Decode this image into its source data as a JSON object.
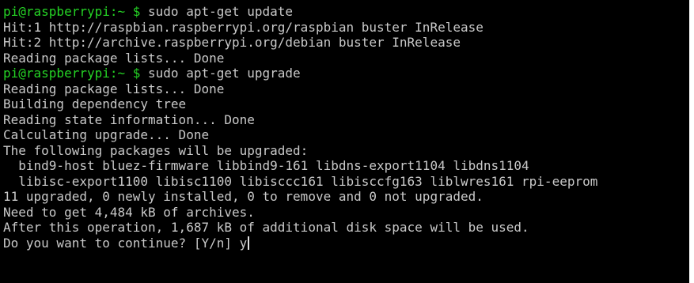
{
  "colors": {
    "background": "#000000",
    "text": "#c9c9c9",
    "prompt": "#25d325"
  },
  "terminal": {
    "lines": [
      {
        "prompt": "pi@raspberrypi:~ $",
        "text": " sudo apt-get update"
      },
      {
        "text": "Hit:1 http://raspbian.raspberrypi.org/raspbian buster InRelease"
      },
      {
        "text": "Hit:2 http://archive.raspberrypi.org/debian buster InRelease"
      },
      {
        "text": "Reading package lists... Done"
      },
      {
        "prompt": "pi@raspberrypi:~ $",
        "text": " sudo apt-get upgrade"
      },
      {
        "text": "Reading package lists... Done"
      },
      {
        "text": "Building dependency tree"
      },
      {
        "text": "Reading state information... Done"
      },
      {
        "text": "Calculating upgrade... Done"
      },
      {
        "text": "The following packages will be upgraded:"
      },
      {
        "text": "  bind9-host bluez-firmware libbind9-161 libdns-export1104 libdns1104"
      },
      {
        "text": "  libisc-export1100 libisc1100 libisccc161 libisccfg163 liblwres161 rpi-eeprom"
      },
      {
        "text": "11 upgraded, 0 newly installed, 0 to remove and 0 not upgraded."
      },
      {
        "text": "Need to get 4,484 kB of archives."
      },
      {
        "text": "After this operation, 1,687 kB of additional disk space will be used."
      },
      {
        "text": "Do you want to continue? [Y/n] y"
      }
    ]
  }
}
